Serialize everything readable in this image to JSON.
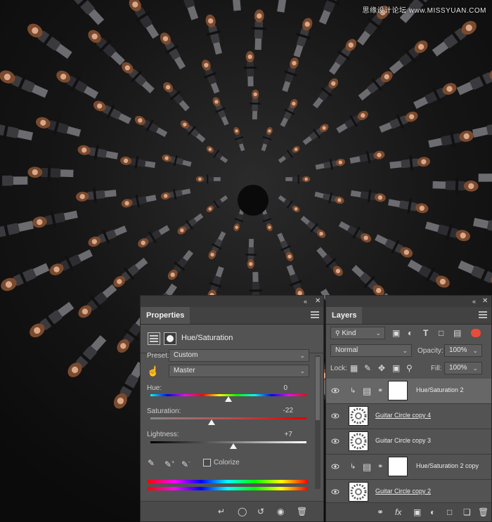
{
  "watermark": "思缘设计论坛 www.MISSYUAN.COM",
  "colors": {
    "panel_bg": "#535353",
    "selected_row": "#676767",
    "lightness_track": "#777777"
  },
  "properties": {
    "tab_label": "Properties",
    "adjustment_title": "Hue/Saturation",
    "preset_label": "Preset:",
    "preset_value": "Custom",
    "channel_value": "Master",
    "hue": {
      "label": "Hue:",
      "value": "0",
      "position": 0.5
    },
    "saturation": {
      "label": "Saturation:",
      "value": "-22",
      "position": 0.39
    },
    "lightness": {
      "label": "Lightness:",
      "value": "+7",
      "position": 0.53
    },
    "colorize_label": "Colorize",
    "colorize_checked": false,
    "icons": [
      "adjustment-icon",
      "mask-icon",
      "hand-target-icon",
      "eyedropper-icon",
      "eyedropper-plus-icon",
      "eyedropper-minus-icon"
    ],
    "footer_icons": [
      "clip-to-layer-icon",
      "view-previous-icon",
      "reset-icon",
      "visibility-icon",
      "trash-icon"
    ]
  },
  "layers": {
    "tab_label": "Layers",
    "filter_kind": "Kind",
    "blend_mode": "Normal",
    "opacity_label": "Opacity:",
    "opacity_value": "100%",
    "lock_label": "Lock:",
    "fill_label": "Fill:",
    "fill_value": "100%",
    "rows": [
      {
        "name": "Hue/Saturation 2",
        "type": "adjustment",
        "selected": true,
        "underlined": false
      },
      {
        "name": "Guitar Circle copy 4",
        "type": "image",
        "selected": false,
        "underlined": true
      },
      {
        "name": "Guitar Circle copy 3",
        "type": "image",
        "selected": false,
        "underlined": false
      },
      {
        "name": "Hue/Saturation 2 copy",
        "type": "adjustment",
        "selected": false,
        "underlined": false
      },
      {
        "name": "Guitar Circle copy 2",
        "type": "image",
        "selected": false,
        "underlined": true
      }
    ],
    "footer_icons": [
      "link-icon",
      "fx-icon",
      "add-mask-icon",
      "adjustment-layer-icon",
      "group-icon",
      "new-layer-icon",
      "trash-icon"
    ]
  }
}
